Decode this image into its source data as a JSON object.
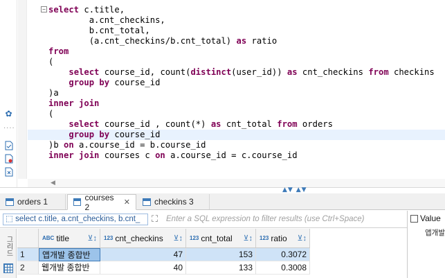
{
  "editor": {
    "lines": [
      [
        "select",
        " c.title,"
      ],
      [
        "",
        "        a.cnt_checkins,"
      ],
      [
        "",
        "        b.cnt_total,"
      ],
      [
        "",
        "        (a.cnt_checkins/b.cnt_total) ",
        "as",
        " ratio"
      ],
      [
        "from",
        ""
      ],
      [
        "",
        "("
      ],
      [
        "",
        "    ",
        "select",
        " course_id, count(",
        "distinct",
        "(user_id)) ",
        "as",
        " cnt_checkins ",
        "from",
        " checkins"
      ],
      [
        "",
        "    ",
        "group by",
        " course_id"
      ],
      [
        "",
        ")a"
      ],
      [
        "inner join",
        ""
      ],
      [
        "",
        "("
      ],
      [
        "",
        "    ",
        "select",
        " course_id , count(*) ",
        "as",
        " cnt_total ",
        "from",
        " orders"
      ],
      [
        "",
        "    ",
        "group by",
        " course_id"
      ],
      [
        "",
        ")b ",
        "on",
        " a.course_id = b.course_id"
      ],
      [
        "inner join",
        " courses c ",
        "on",
        " a.course_id = c.course_id"
      ]
    ],
    "highlight_line": 12
  },
  "tabs": [
    {
      "label": "orders 1",
      "active": false
    },
    {
      "label": "courses 2",
      "active": true,
      "close": "✕"
    },
    {
      "label": "checkins 3",
      "active": false
    }
  ],
  "filter": {
    "query": "select c.title, a.cnt_checkins, b.cnt_",
    "placeholder": "Enter a SQL expression to filter results (use Ctrl+Space)"
  },
  "results": {
    "strip_label": "그리드",
    "columns": [
      {
        "type": "ABC",
        "name": "title"
      },
      {
        "type": "123",
        "name": "cnt_checkins"
      },
      {
        "type": "123",
        "name": "cnt_total"
      },
      {
        "type": "123",
        "name": "ratio"
      }
    ],
    "rows": [
      {
        "num": "1",
        "title": "앱개발 종합반",
        "cnt_checkins": "47",
        "cnt_total": "153",
        "ratio": "0.3072"
      },
      {
        "num": "2",
        "title": "웹개발 종합반",
        "cnt_checkins": "40",
        "cnt_total": "133",
        "ratio": "0.3008"
      }
    ]
  },
  "value_panel": {
    "label": "Value",
    "value": "앱개발 종"
  },
  "icons": {
    "gutter": [
      "gear-icon",
      "file-icon",
      "file-error-icon",
      "file-x-icon"
    ],
    "sort": "sort-filter-icon"
  },
  "colors": {
    "keyword": "#7f0055",
    "accent": "#3d7ab8",
    "selection": "#cfe3f7"
  }
}
